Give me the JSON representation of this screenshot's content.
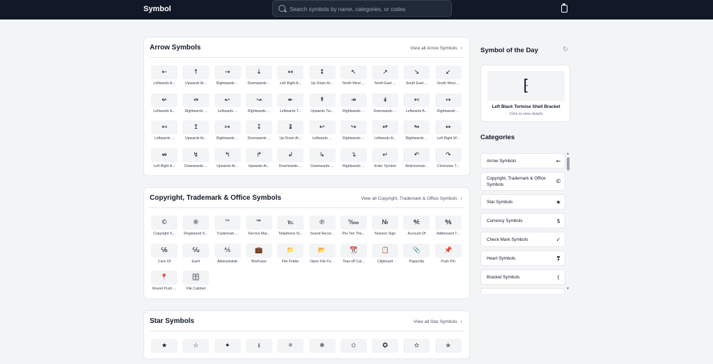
{
  "header": {
    "logo": "Symbol",
    "search_placeholder": "Search symbols by name, categories, or codes",
    "clipboard_icon": "clipboard-icon"
  },
  "sections": [
    {
      "title": "Arrow Symbols",
      "view_all": "View all Arrow Symbols",
      "items": [
        {
          "s": "←",
          "l": "Leftwards A..."
        },
        {
          "s": "↑",
          "l": "Upwards Ar..."
        },
        {
          "s": "→",
          "l": "Rightwards ..."
        },
        {
          "s": "↓",
          "l": "Downwards ..."
        },
        {
          "s": "↔",
          "l": "Left Right A..."
        },
        {
          "s": "↕",
          "l": "Up Down Ar..."
        },
        {
          "s": "↖",
          "l": "North West ..."
        },
        {
          "s": "↗",
          "l": "North East ..."
        },
        {
          "s": "↘",
          "l": "South East ..."
        },
        {
          "s": "↙",
          "l": "South West ..."
        },
        {
          "s": "↚",
          "l": "Leftwards A..."
        },
        {
          "s": "↛",
          "l": "Rightwards ..."
        },
        {
          "s": "↜",
          "l": "Leftwards ..."
        },
        {
          "s": "↝",
          "l": "Rightwards ..."
        },
        {
          "s": "↞",
          "l": "Leftwards T..."
        },
        {
          "s": "↟",
          "l": "Upwards Tw..."
        },
        {
          "s": "↠",
          "l": "Rightwards ..."
        },
        {
          "s": "↡",
          "l": "Downwards ..."
        },
        {
          "s": "↢",
          "l": "Leftwards A..."
        },
        {
          "s": "↣",
          "l": "Rightwards ..."
        },
        {
          "s": "↤",
          "l": "Leftwards ..."
        },
        {
          "s": "↥",
          "l": "Upwards Ar..."
        },
        {
          "s": "↦",
          "l": "Rightwards ..."
        },
        {
          "s": "↧",
          "l": "Downwards ..."
        },
        {
          "s": "↨",
          "l": "Up Down Ar..."
        },
        {
          "s": "↩",
          "l": "Leftwards ..."
        },
        {
          "s": "↪",
          "l": "Rightwards ..."
        },
        {
          "s": "↫",
          "l": "Leftwards A..."
        },
        {
          "s": "↬",
          "l": "Rightwards ..."
        },
        {
          "s": "↭",
          "l": "Left Right W..."
        },
        {
          "s": "↮",
          "l": "Left Right A..."
        },
        {
          "s": "↯",
          "l": "Downwards ..."
        },
        {
          "s": "↰",
          "l": "Upwards Ar..."
        },
        {
          "s": "↱",
          "l": "Upwards Ar..."
        },
        {
          "s": "↲",
          "l": "Downwards ..."
        },
        {
          "s": "↳",
          "l": "Downwards ..."
        },
        {
          "s": "↴",
          "l": "Rightwards ..."
        },
        {
          "s": "↵",
          "l": "Enter Symbol"
        },
        {
          "s": "↶",
          "l": "Anticlockwis..."
        },
        {
          "s": "↷",
          "l": "Clockwise T..."
        }
      ]
    },
    {
      "title": "Copyright, Trademark & Office Symbols",
      "view_all": "View all Copyright, Trademark & Office Symbols",
      "items": [
        {
          "s": "©",
          "l": "Copyright S..."
        },
        {
          "s": "®",
          "l": "Registered S..."
        },
        {
          "s": "™",
          "l": "Trademark ..."
        },
        {
          "s": "℠",
          "l": "Service Mar..."
        },
        {
          "s": "℡",
          "l": "Telephone Si..."
        },
        {
          "s": "℗",
          "l": "Sound Recor..."
        },
        {
          "s": "‱",
          "l": "Per Ten Tho..."
        },
        {
          "s": "№",
          "l": "Numero Sign"
        },
        {
          "s": "℀",
          "l": "Account Of"
        },
        {
          "s": "℁",
          "l": "Addressed T..."
        },
        {
          "s": "℅",
          "l": "Care Of"
        },
        {
          "s": "℆",
          "l": "Each"
        },
        {
          "s": "⅍",
          "l": "Aktieselskab"
        },
        {
          "s": "💼",
          "l": "Briefcase"
        },
        {
          "s": "📁",
          "l": "File Folder"
        },
        {
          "s": "📂",
          "l": "Open File Fo..."
        },
        {
          "s": "📆",
          "l": "Tear-off Cal..."
        },
        {
          "s": "📋",
          "l": "Clipboard"
        },
        {
          "s": "📎",
          "l": "Paperclip"
        },
        {
          "s": "📌",
          "l": "Push Pin"
        },
        {
          "s": "📍",
          "l": "Round Push ..."
        },
        {
          "s": "🗄",
          "l": "File Cabinet"
        }
      ]
    },
    {
      "title": "Star Symbols",
      "view_all": "View all Star Symbols",
      "items": [
        {
          "s": "★",
          "l": ""
        },
        {
          "s": "☆",
          "l": ""
        },
        {
          "s": "✦",
          "l": ""
        },
        {
          "s": "⭳",
          "l": ""
        },
        {
          "s": "⍟",
          "l": ""
        },
        {
          "s": "✵",
          "l": ""
        },
        {
          "s": "✩",
          "l": ""
        },
        {
          "s": "✪",
          "l": ""
        },
        {
          "s": "✫",
          "l": ""
        },
        {
          "s": "✭",
          "l": ""
        }
      ]
    }
  ],
  "sidebar": {
    "sotd_title": "Symbol of the Day",
    "sotd_symbol": "⁅",
    "sotd_name": "Left Black Tortoise Shell Bracket",
    "sotd_hint": "Click to view details",
    "categories_title": "Categories",
    "categories": [
      {
        "label": "Arrow Symbols",
        "sym": "←"
      },
      {
        "label": "Copyright, Trademark & Office Symbols",
        "sym": "©"
      },
      {
        "label": "Star Symbols",
        "sym": "★"
      },
      {
        "label": "Currency Symbols",
        "sym": "$"
      },
      {
        "label": "Check Mark Symbols",
        "sym": "✓"
      },
      {
        "label": "Heart Symbols",
        "sym": "❣"
      },
      {
        "label": "Bracket Symbols",
        "sym": "("
      },
      {
        "label": "",
        "sym": ""
      }
    ]
  },
  "colors": {
    "topbar": "#111827",
    "card": "#ffffff",
    "tile": "#f3f4f6"
  }
}
